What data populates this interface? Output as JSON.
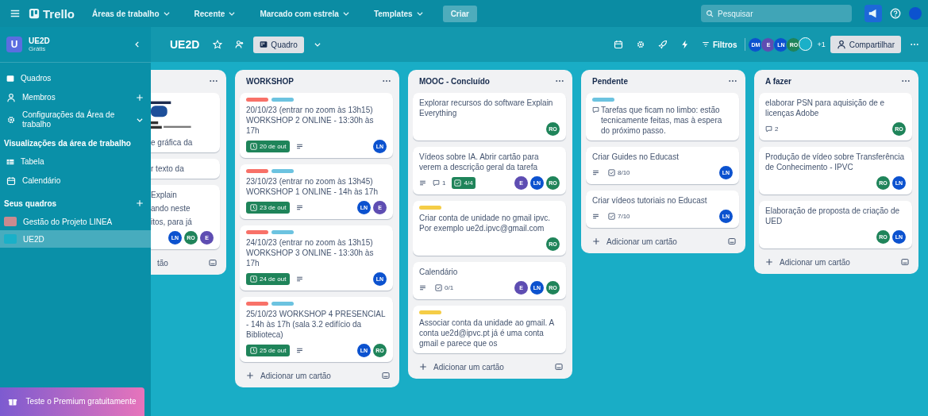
{
  "topbar": {
    "logo": "Trello",
    "menus": [
      {
        "label": "Áreas de trabalho"
      },
      {
        "label": "Recente"
      },
      {
        "label": "Marcado com estrela"
      },
      {
        "label": "Templates"
      }
    ],
    "create": "Criar",
    "search": {
      "placeholder": "Pesquisar"
    }
  },
  "sidebar": {
    "workspace": {
      "initial": "U",
      "name": "UE2D",
      "plan": "Grátis"
    },
    "items": [
      {
        "label": "Quadros",
        "kind": "boards"
      },
      {
        "label": "Membros",
        "kind": "members"
      },
      {
        "label": "Configurações da Área de trabalho",
        "kind": "settings"
      }
    ],
    "views": {
      "heading": "Visualizações da área de trabalho",
      "items": [
        {
          "label": "Tabela",
          "kind": "table"
        },
        {
          "label": "Calendário",
          "kind": "calendar"
        }
      ]
    },
    "boards": {
      "heading": "Seus quadros",
      "items": [
        {
          "label": "Gestão do Projeto LINEA",
          "color": "#c98a8f",
          "selected": false
        },
        {
          "label": "UE2D",
          "color": "#1ab0c8",
          "selected": true
        }
      ]
    },
    "promo": "Teste o Premium gratuitamente"
  },
  "board_header": {
    "title": "UE2D",
    "view": "Quadro",
    "filter": "Filtros",
    "members": [
      {
        "initials": "DM",
        "color": "#0c52cf"
      },
      {
        "initials": "E",
        "color": "#5e4db2"
      },
      {
        "initials": "LN",
        "color": "#0c52cf"
      },
      {
        "initials": "RO",
        "color": "#1f845a"
      },
      {
        "color": "#1ab0c8"
      }
    ],
    "more_members": "+1",
    "share": "Compartilhar"
  },
  "lists": [
    {
      "kind": "partial",
      "cards": [
        {
          "cover": true,
          "lines": [
            "e gráfica da"
          ]
        },
        {
          "lines": [
            "r texto da"
          ]
        },
        {
          "lines": [
            "Explain",
            "ando neste",
            "itos, para já"
          ],
          "members": [
            {
              "initials": "LN",
              "color": "#0c52cf"
            },
            {
              "initials": "RO",
              "color": "#1f845a"
            },
            {
              "initials": "E",
              "color": "#5e4db2"
            }
          ]
        }
      ],
      "add_label": "tão"
    },
    {
      "kind": "full",
      "title": "WORKSHOP",
      "cards": [
        {
          "labels": [
            {
              "color": "#f87168"
            },
            {
              "color": "#6cc3e0"
            }
          ],
          "title": "20/10/23 (entrar no zoom às 13h15) WORKSHOP 2 ONLINE - 13:30h às 17h",
          "badges": [
            {
              "kind": "due",
              "text": "20 de out",
              "complete": true
            },
            {
              "kind": "description"
            }
          ],
          "members": [
            {
              "initials": "LN",
              "color": "#0c52cf"
            }
          ]
        },
        {
          "labels": [
            {
              "color": "#f87168"
            },
            {
              "color": "#6cc3e0"
            }
          ],
          "title": "23/10/23 (entrar no zoom às 13h45) WORKSHOP 1 ONLINE - 14h às 17h",
          "badges": [
            {
              "kind": "due",
              "text": "23 de out",
              "complete": true
            },
            {
              "kind": "description"
            }
          ],
          "members": [
            {
              "initials": "LN",
              "color": "#0c52cf"
            },
            {
              "initials": "E",
              "color": "#5e4db2"
            }
          ]
        },
        {
          "labels": [
            {
              "color": "#f87168"
            },
            {
              "color": "#6cc3e0"
            }
          ],
          "title": "24/10/23 (entrar no zoom às 13h15) WORKSHOP 3 ONLINE - 13:30h às 17h",
          "badges": [
            {
              "kind": "due",
              "text": "24 de out",
              "complete": true
            },
            {
              "kind": "description"
            }
          ],
          "members": [
            {
              "initials": "LN",
              "color": "#0c52cf"
            }
          ]
        },
        {
          "labels": [
            {
              "color": "#f87168"
            },
            {
              "color": "#6cc3e0"
            }
          ],
          "title": "25/10/23 WORKSHOP 4 PRESENCIAL - 14h às 17h (sala 3.2 edifício da Biblioteca)",
          "badges": [
            {
              "kind": "due",
              "text": "25 de out",
              "complete": true
            },
            {
              "kind": "description"
            }
          ],
          "members": [
            {
              "initials": "LN",
              "color": "#0c52cf"
            },
            {
              "initials": "RO",
              "color": "#1f845a"
            }
          ]
        }
      ],
      "add_label": "Adicionar um cartão"
    },
    {
      "kind": "full",
      "title": "MOOC - Concluído",
      "cards": [
        {
          "title": "Explorar recursos do software Explain Everything",
          "members": [
            {
              "initials": "RO",
              "color": "#1f845a"
            }
          ]
        },
        {
          "title": "Vídeos sobre IA. Abrir cartão para verem a descrição geral da tarefa",
          "badges": [
            {
              "kind": "description"
            },
            {
              "kind": "comments",
              "text": "1"
            },
            {
              "kind": "checklist",
              "text": "4/4",
              "complete": true
            }
          ],
          "members": [
            {
              "initials": "E",
              "color": "#5e4db2"
            },
            {
              "initials": "LN",
              "color": "#0c52cf"
            },
            {
              "initials": "RO",
              "color": "#1f845a"
            }
          ]
        },
        {
          "labels": [
            {
              "color": "#f5cd47"
            }
          ],
          "title": "Criar conta de unidade no gmail ipvc. Por exemplo ue2d.ipvc@gmail.com",
          "members": [
            {
              "initials": "RO",
              "color": "#1f845a"
            }
          ]
        },
        {
          "title": "Calendário",
          "badges": [
            {
              "kind": "description"
            },
            {
              "kind": "checklist",
              "text": "0/1",
              "complete": false
            }
          ],
          "members": [
            {
              "initials": "E",
              "color": "#5e4db2"
            },
            {
              "initials": "LN",
              "color": "#0c52cf"
            },
            {
              "initials": "RO",
              "color": "#1f845a"
            }
          ]
        },
        {
          "labels": [
            {
              "color": "#f5cd47"
            }
          ],
          "title": "Associar conta da unidade ao gmail. A conta ue2d@ipvc.pt já é uma conta gmail e parece que os"
        }
      ],
      "add_label": "Adicionar um cartão"
    },
    {
      "kind": "full",
      "title": "Pendente",
      "cards": [
        {
          "labels": [
            {
              "color": "#6cc3e0"
            }
          ],
          "comment_icon": true,
          "title": "Tarefas que ficam no limbo: estão tecnicamente feitas, mas à espera do próximo passo."
        },
        {
          "title": "Criar Guides no Educast",
          "badges": [
            {
              "kind": "description"
            },
            {
              "kind": "checklist",
              "text": "8/10",
              "complete": false
            }
          ],
          "members": [
            {
              "initials": "LN",
              "color": "#0c52cf"
            }
          ]
        },
        {
          "title": "Criar vídeos tutoriais no Educast",
          "badges": [
            {
              "kind": "description"
            },
            {
              "kind": "checklist",
              "text": "7/10",
              "complete": false
            }
          ],
          "members": [
            {
              "initials": "LN",
              "color": "#0c52cf"
            }
          ]
        }
      ],
      "add_label": "Adicionar um cartão"
    },
    {
      "kind": "full",
      "title": "A fazer",
      "cards": [
        {
          "title": "elaborar PSN para aquisição de e licenças Adobe",
          "badges": [
            {
              "kind": "comments",
              "text": "2"
            }
          ],
          "members": [
            {
              "initials": "RO",
              "color": "#1f845a"
            }
          ]
        },
        {
          "title": "Produção de vídeo sobre Transferência de Conhecimento - IPVC",
          "members": [
            {
              "initials": "RO",
              "color": "#1f845a"
            },
            {
              "initials": "LN",
              "color": "#0c52cf"
            }
          ]
        },
        {
          "title": "Elaboração de proposta de criação de UED",
          "members": [
            {
              "initials": "RO",
              "color": "#1f845a"
            },
            {
              "initials": "LN",
              "color": "#0c52cf"
            }
          ]
        }
      ],
      "add_label": "Adicionar um cartão"
    }
  ]
}
